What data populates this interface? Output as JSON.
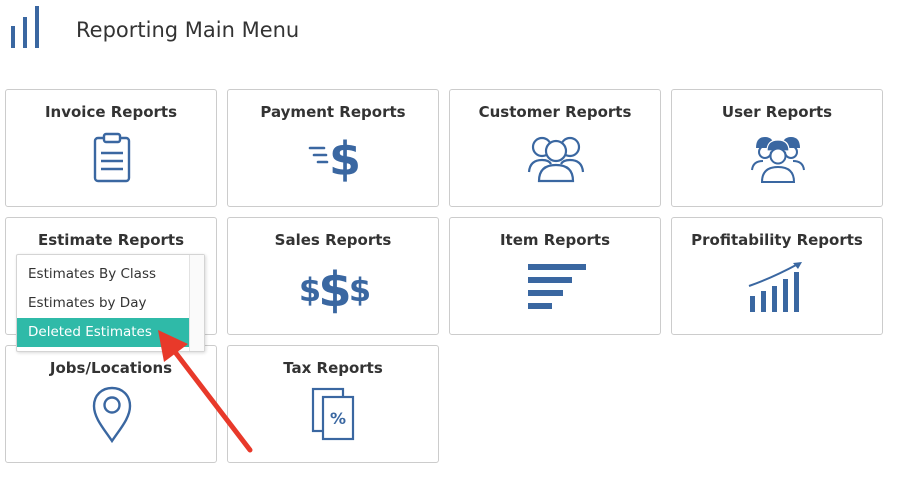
{
  "header": {
    "title": "Reporting Main Menu",
    "logo_icon": "bar-chart-icon"
  },
  "tiles": [
    {
      "label": "Invoice Reports",
      "icon": "clipboard-icon"
    },
    {
      "label": "Payment Reports",
      "icon": "fast-dollar-icon"
    },
    {
      "label": "Customer Reports",
      "icon": "users-group-icon"
    },
    {
      "label": "User Reports",
      "icon": "workers-icon"
    },
    {
      "label": "Estimate Reports",
      "icon": "estimate-icon"
    },
    {
      "label": "Sales Reports",
      "icon": "triple-dollar-icon"
    },
    {
      "label": "Item Reports",
      "icon": "bars-list-icon"
    },
    {
      "label": "Profitability Reports",
      "icon": "growth-chart-icon"
    },
    {
      "label": "Jobs/Locations",
      "icon": "map-pin-icon"
    },
    {
      "label": "Tax Reports",
      "icon": "tax-percent-icon"
    }
  ],
  "estimate_dropdown": {
    "items": [
      {
        "label": "Estimates By Class",
        "selected": false
      },
      {
        "label": "Estimates by Day",
        "selected": false
      },
      {
        "label": "Deleted Estimates",
        "selected": true
      }
    ]
  },
  "colors": {
    "icon_blue": "#3a67a1",
    "highlight": "#2fbaa8",
    "arrow_red": "#e8392a",
    "border": "#cccccc",
    "title_text": "#333333"
  }
}
